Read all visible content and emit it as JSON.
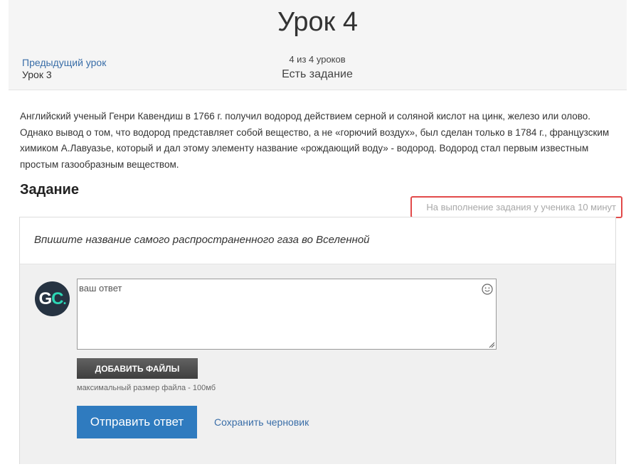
{
  "header": {
    "title": "Урок 4",
    "prev_link_label": "Предыдущий урок",
    "prev_lesson_name": "Урок 3",
    "lesson_count": "4 из 4 уроков",
    "lesson_status": "Есть задание"
  },
  "intro": {
    "text": "Английский ученый Генри Кавендиш в 1766 г. получил водород действием серной и соляной кислот на цинк, железо или олово. Однако вывод о том, что водород представляет собой вещество, а не «горючий воздух», был сделан только в 1784 г., французским химиком А.Лавуазье, который и дал этому элементу название «рождающий воду» - водород. Водород стал первым известным простым газообразным веществом."
  },
  "task": {
    "heading": "Задание",
    "time_note": "На выполнение задания у ученика 10 минут",
    "question": "Впишите название самого распространенного газа во Вселенной",
    "avatar": {
      "letter1": "G",
      "letter2": "C",
      "dot": "."
    },
    "answer_value": "",
    "answer_placeholder": "ваш ответ",
    "add_files_label": "ДОБАВИТЬ ФАЙЛЫ",
    "file_size_note": "максимальный размер файла - 100мб",
    "submit_label": "Отправить ответ",
    "save_draft_label": "Сохранить черновик"
  },
  "colors": {
    "link": "#3a6ea8",
    "submit_button": "#2f7bbf",
    "highlight_border": "#e24a4a",
    "avatar_bg": "#263342",
    "avatar_accent": "#2dd6b5"
  },
  "icons": {
    "emoji": "smiley-icon",
    "resize": "resize-handle-icon"
  }
}
